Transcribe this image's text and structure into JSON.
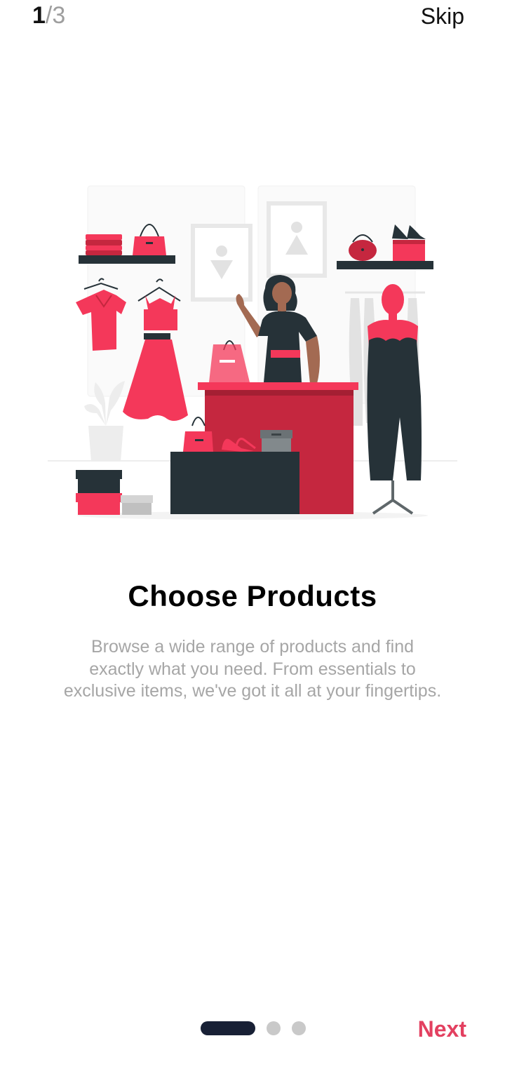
{
  "progress": {
    "current": "1",
    "separator_total": "/3"
  },
  "header": {
    "skip_label": "Skip"
  },
  "illustration": {
    "name": "clothing-store-illustration"
  },
  "content": {
    "title": "Choose Products",
    "description": "Browse a wide range of products and find exactly what you need. From essentials to exclusive items, we've got it all at your fingertips."
  },
  "pagination": {
    "total_pages": 3,
    "active_index": 0
  },
  "footer": {
    "next_label": "Next"
  },
  "colors": {
    "accent": "#e34060",
    "brand_dark": "#182035",
    "product_red": "#f4385a",
    "text_muted": "#a6a6a6"
  }
}
